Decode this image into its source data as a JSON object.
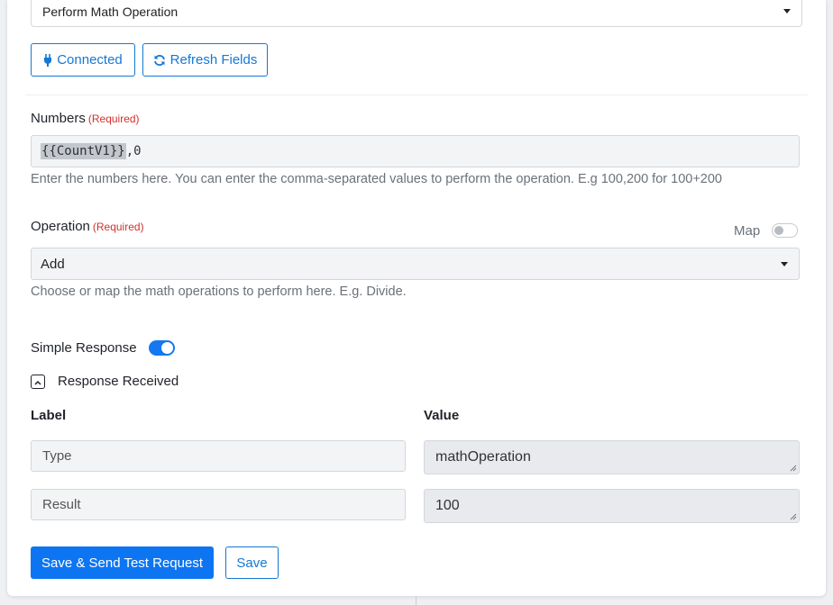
{
  "action_select": {
    "value": "Perform Math Operation"
  },
  "buttons": {
    "connected": "Connected",
    "refresh": "Refresh Fields"
  },
  "numbers": {
    "label": "Numbers",
    "required": "(Required)",
    "token": "{{CountV1}}",
    "suffix": ",0",
    "help": "Enter the numbers here. You can enter the comma-separated values to perform the operation. E.g 100,200 for 100+200"
  },
  "operation": {
    "label": "Operation",
    "required": "(Required)",
    "map_label": "Map",
    "map_enabled": false,
    "value": "Add",
    "help": "Choose or map the math operations to perform here. E.g. Divide."
  },
  "simple_response": {
    "label": "Simple Response",
    "enabled": true
  },
  "response": {
    "title": "Response Received",
    "label_header": "Label",
    "value_header": "Value",
    "rows": [
      {
        "label": "Type",
        "value": "mathOperation"
      },
      {
        "label": "Result",
        "value": "100"
      }
    ]
  },
  "footer": {
    "save_send": "Save & Send Test Request",
    "save": "Save"
  },
  "colors": {
    "accent": "#1478d4",
    "primary": "#0d75f2",
    "required": "#d0312d"
  }
}
